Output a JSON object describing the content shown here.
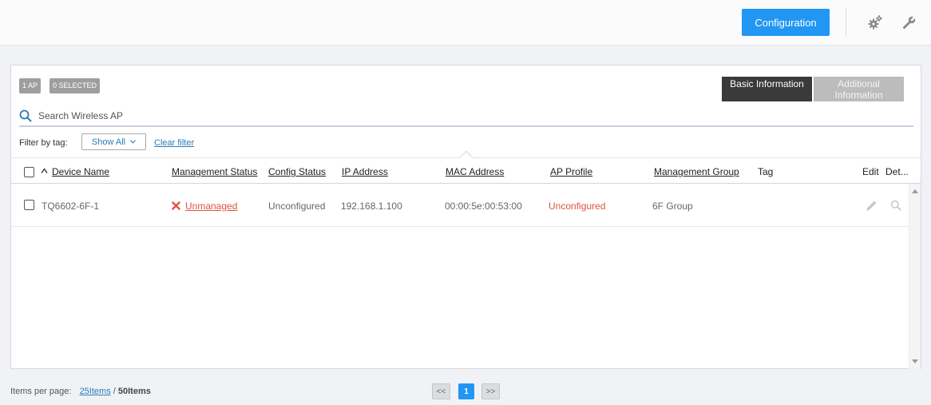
{
  "header": {
    "config_label": "Configuration",
    "settings_icon": "gears-icon",
    "tools_icon": "wrench-icon"
  },
  "summary": {
    "ap_count": "1 AP",
    "selected_count": "0 SELECTED"
  },
  "view_tabs": [
    {
      "label": "Basic Information",
      "active": true
    },
    {
      "label": "Additional Information",
      "active": false
    }
  ],
  "search": {
    "placeholder": "Search Wireless AP"
  },
  "filter": {
    "label": "Filter by tag:",
    "selected": "Show All",
    "clear_label": "Clear filter"
  },
  "table": {
    "columns": {
      "device_name": "Device Name",
      "management_status": "Management Status",
      "config_status": "Config Status",
      "ip_address": "IP Address",
      "mac_address": "MAC Address",
      "ap_profile": "AP Profile",
      "management_group": "Management Group",
      "tag": "Tag",
      "edit": "Edit",
      "details": "Det..."
    },
    "rows": [
      {
        "device_name": "TQ6602-6F-1",
        "management_status": "Unmanaged",
        "config_status": "Unconfigured",
        "ip_address": "192.168.1.100",
        "mac_address": "00:00:5e:00:53:00",
        "ap_profile": "Unconfigured",
        "management_group": "6F Group",
        "tag": ""
      }
    ]
  },
  "pagination": {
    "label": "Items per page:",
    "option_25": "25Items",
    "separator": "/",
    "option_50": "50Items",
    "prev": "<<",
    "current_page": "1",
    "next": ">>"
  },
  "colors": {
    "accent": "#2196f3",
    "error": "#e0533e",
    "active_tab": "#3a3a3a",
    "inactive_tab": "#bcbcbc"
  }
}
